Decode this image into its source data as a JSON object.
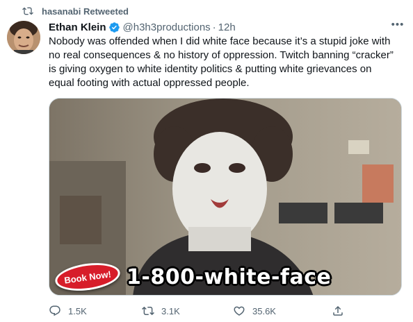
{
  "retweet": {
    "text": "hasanabi Retweeted",
    "icon": "retweet-icon"
  },
  "author": {
    "name": "Ethan Klein",
    "handle": "@h3h3productions",
    "separator": "·",
    "time": "12h",
    "verified": true,
    "verified_color": "#1d9bf0"
  },
  "tweet": {
    "text": "Nobody was offended when I did white face because it’s a stupid joke with no real consequences & no history of oppression. Twitch banning “cracker” is giving oxygen to white identity politics & putting white grievances on equal footing with actual oppressed people."
  },
  "media": {
    "badge": "Book Now!",
    "caption": "1-800-white-face",
    "badge_color": "#d71d2a"
  },
  "actions": {
    "reply": {
      "count": "1.5K",
      "icon": "reply-icon"
    },
    "retweet": {
      "count": "3.1K",
      "icon": "retweet-icon"
    },
    "like": {
      "count": "35.6K",
      "icon": "heart-icon"
    },
    "share": {
      "icon": "share-icon"
    }
  },
  "colors": {
    "text": "#0f1419",
    "secondary": "#536471",
    "border": "#cfd9de"
  }
}
